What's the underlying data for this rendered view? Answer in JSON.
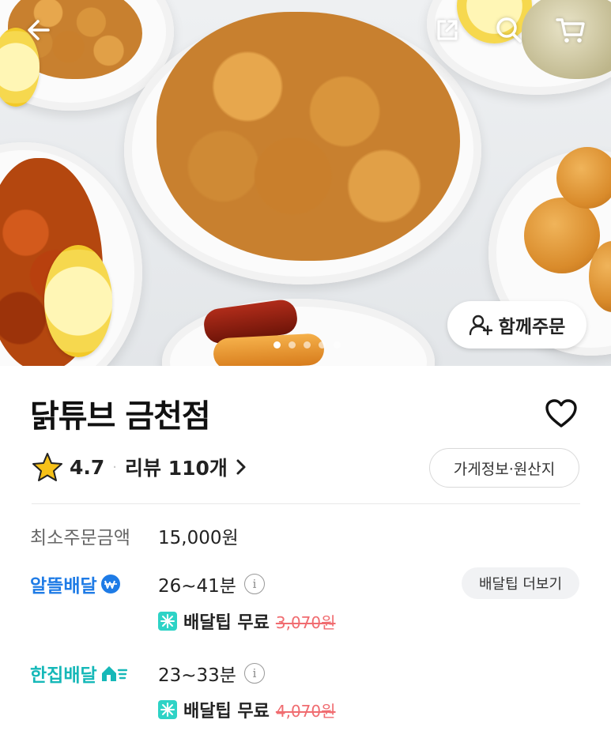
{
  "store": {
    "name": "닭튜브 금천점"
  },
  "rating": {
    "score": "4.7",
    "review_label": "리뷰 110개"
  },
  "buttons": {
    "together_order": "함께주문",
    "store_info": "가게정보·원산지",
    "delivery_tip_more": "배달팁 더보기"
  },
  "min_order": {
    "label": "최소주문금액",
    "value": "15,000원"
  },
  "delivery": [
    {
      "name": "알뜰배달",
      "time": "26~41분",
      "tip_label": "배달팁 무료",
      "original_tip": "3,070원",
      "color": "#1e7be6"
    },
    {
      "name": "한집배달",
      "time": "23~33분",
      "tip_label": "배달팁 무료",
      "original_tip": "4,070원",
      "color": "#16b8b8"
    }
  ],
  "carousel": {
    "count": 5,
    "active_index": 0
  },
  "icons": [
    "back-arrow-icon",
    "share-icon",
    "search-icon",
    "cart-icon",
    "add-user-icon",
    "heart-icon",
    "star-icon",
    "chevron-right-icon",
    "info-icon",
    "coin-badge-icon",
    "fast-home-icon",
    "free-tip-icon"
  ],
  "colors": {
    "star": "#f6c118",
    "saver_blue": "#1e7be6",
    "single_teal": "#16b8b8",
    "strike_red": "#f06c70"
  }
}
